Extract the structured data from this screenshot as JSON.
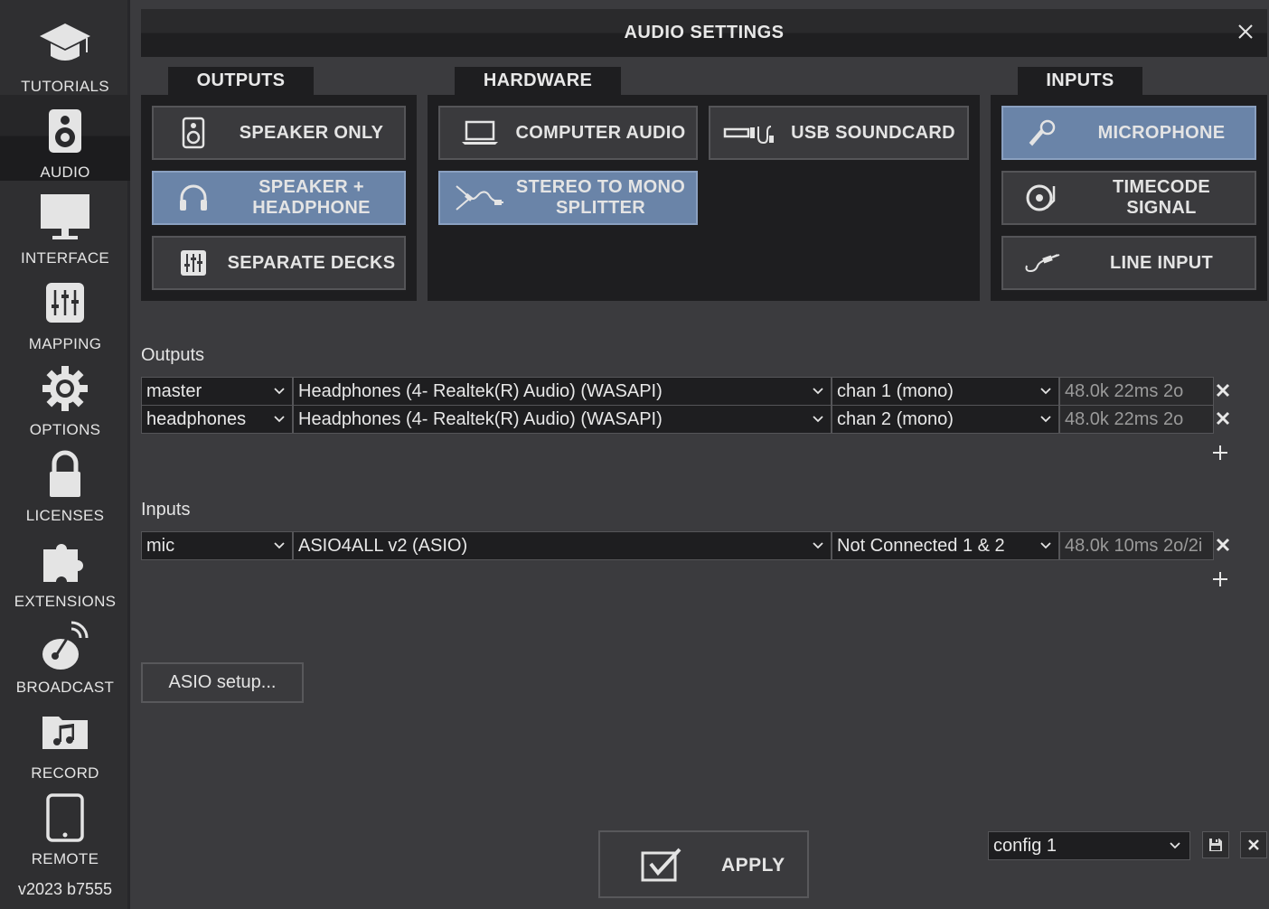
{
  "sidebar": {
    "items": [
      {
        "label": "TUTORIALS",
        "icon": "graduation-cap-icon"
      },
      {
        "label": "AUDIO",
        "icon": "speaker-icon",
        "active": true
      },
      {
        "label": "INTERFACE",
        "icon": "monitor-icon"
      },
      {
        "label": "MAPPING",
        "icon": "sliders-icon"
      },
      {
        "label": "OPTIONS",
        "icon": "gear-icon"
      },
      {
        "label": "LICENSES",
        "icon": "lock-icon"
      },
      {
        "label": "EXTENSIONS",
        "icon": "puzzle-icon"
      },
      {
        "label": "BROADCAST",
        "icon": "satellite-dish-icon"
      },
      {
        "label": "RECORD",
        "icon": "music-folder-icon"
      },
      {
        "label": "REMOTE",
        "icon": "tablet-icon"
      }
    ],
    "version": "v2023 b7555"
  },
  "window": {
    "title": "AUDIO SETTINGS"
  },
  "outputs_panel": {
    "tab": "OUTPUTS",
    "buttons": [
      {
        "label": "SPEAKER ONLY",
        "active": false
      },
      {
        "label": "SPEAKER +\nHEADPHONE",
        "active": true
      },
      {
        "label": "SEPARATE DECKS",
        "active": false
      }
    ]
  },
  "hardware_panel": {
    "tab": "HARDWARE",
    "buttons": [
      {
        "label": "COMPUTER AUDIO",
        "active": false
      },
      {
        "label": "USB SOUNDCARD",
        "active": false
      },
      {
        "label": "STEREO TO MONO\nSPLITTER",
        "active": true
      }
    ]
  },
  "inputs_panel": {
    "tab": "INPUTS",
    "buttons": [
      {
        "label": "MICROPHONE",
        "active": true
      },
      {
        "label": "TIMECODE SIGNAL",
        "active": false
      },
      {
        "label": "LINE INPUT",
        "active": false
      }
    ]
  },
  "outputs": {
    "label": "Outputs",
    "rows": [
      {
        "role": "master",
        "device": "Headphones (4- Realtek(R) Audio) (WASAPI)",
        "channel": "chan 1 (mono)",
        "info": "48.0k 22ms 2o"
      },
      {
        "role": "headphones",
        "device": "Headphones (4- Realtek(R) Audio) (WASAPI)",
        "channel": "chan 2 (mono)",
        "info": "48.0k 22ms 2o"
      }
    ]
  },
  "inputs": {
    "label": "Inputs",
    "rows": [
      {
        "role": "mic",
        "device": "ASIO4ALL v2 (ASIO)",
        "channel": "Not Connected 1 & 2",
        "info": "48.0k 10ms 2o/2i"
      }
    ]
  },
  "asio_button": "ASIO setup...",
  "apply_button": "APPLY",
  "config": {
    "selected": "config 1"
  },
  "colors": {
    "accent": "#6a84a8",
    "panel": "#1e1e20",
    "background": "#3b3b3e"
  }
}
